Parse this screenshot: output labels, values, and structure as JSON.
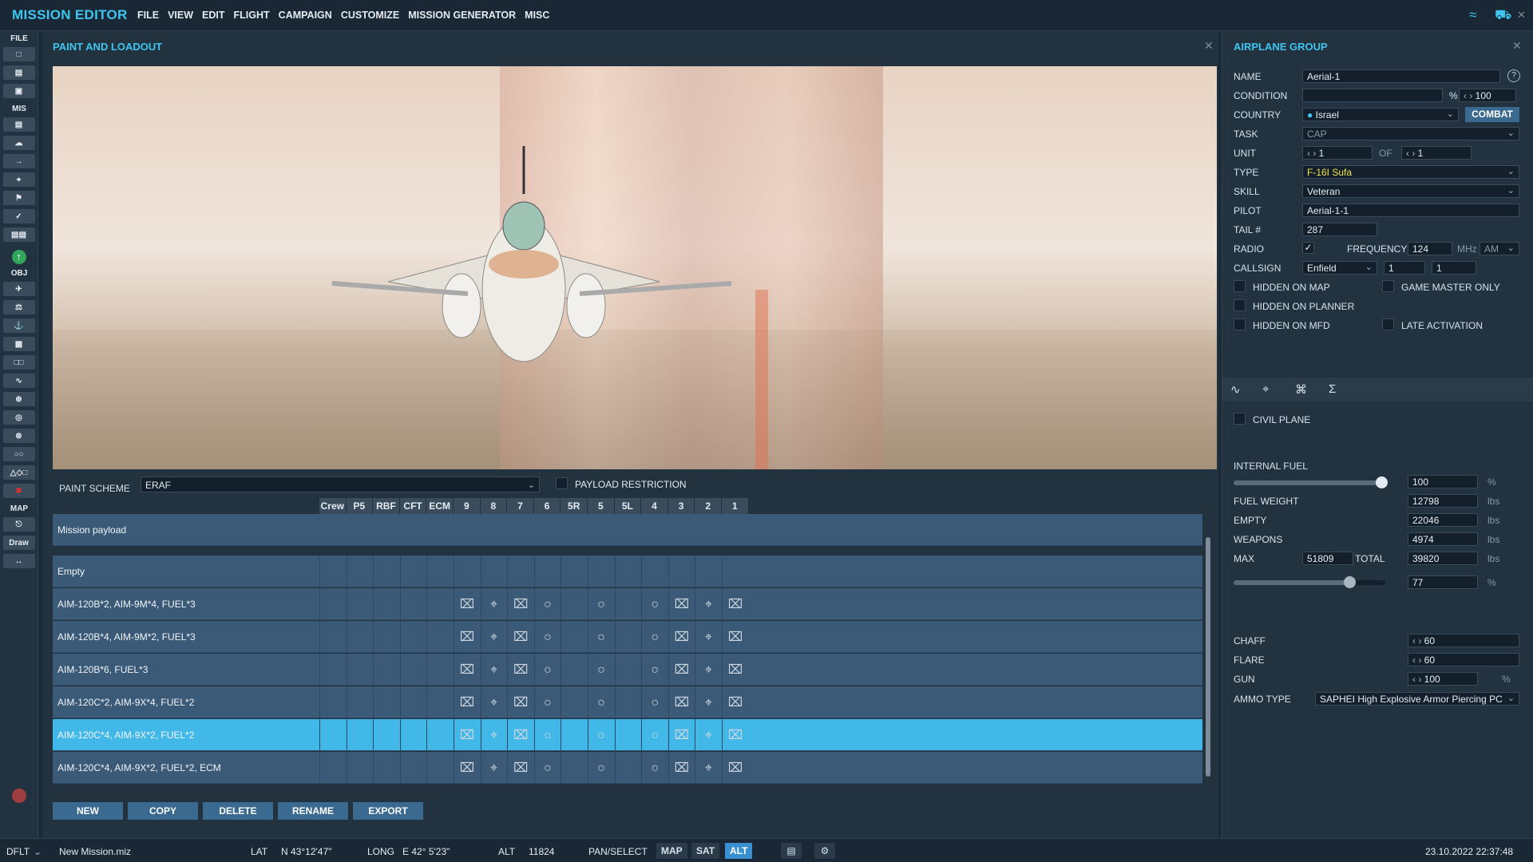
{
  "app": {
    "title": "MISSION EDITOR"
  },
  "menu": [
    "FILE",
    "VIEW",
    "EDIT",
    "FLIGHT",
    "CAMPAIGN",
    "CUSTOMIZE",
    "MISSION GENERATOR",
    "MISC"
  ],
  "toolbar": {
    "file": "FILE",
    "mis": "MIS",
    "obj": "OBJ",
    "map": "MAP",
    "draw": "Draw"
  },
  "paint_panel": {
    "title": "PAINT AND LOADOUT",
    "paint_scheme_label": "PAINT SCHEME",
    "paint_scheme_value": "ERAF",
    "payload_restriction_label": "PAYLOAD RESTRICTION",
    "columns": [
      "Crew",
      "P5",
      "RBF",
      "CFT",
      "ECM",
      "9",
      "8",
      "7",
      "6",
      "5R",
      "5",
      "5L",
      "4",
      "3",
      "2",
      "1"
    ],
    "mission_payload_label": "Mission payload",
    "loadouts": [
      "Empty",
      "AIM-120B*2, AIM-9M*4, FUEL*3",
      "AIM-120B*4, AIM-9M*2, FUEL*3",
      "AIM-120B*6, FUEL*3",
      "AIM-120C*2, AIM-9X*4, FUEL*2",
      "AIM-120C*4, AIM-9X*2, FUEL*2",
      "AIM-120C*4, AIM-9X*2, FUEL*2, ECM"
    ],
    "selected_index": 5,
    "buttons": {
      "new": "NEW",
      "copy": "COPY",
      "delete": "DELETE",
      "rename": "RENAME",
      "export": "EXPORT"
    }
  },
  "airplane_group": {
    "title": "AIRPLANE GROUP",
    "name_label": "NAME",
    "name_value": "Aerial-1",
    "condition_label": "CONDITION",
    "condition_pct": "%",
    "condition_value": "100",
    "country_label": "COUNTRY",
    "country_value": "Israel",
    "combat_button": "COMBAT",
    "task_label": "TASK",
    "task_value": "CAP",
    "unit_label": "UNIT",
    "unit_value": "1",
    "of_label": "OF",
    "of_value": "1",
    "type_label": "TYPE",
    "type_value": "F-16I Sufa",
    "skill_label": "SKILL",
    "skill_value": "Veteran",
    "pilot_label": "PILOT",
    "pilot_value": "Aerial-1-1",
    "tail_label": "TAIL #",
    "tail_value": "287",
    "radio_label": "RADIO",
    "frequency_label": "FREQUENCY",
    "frequency_value": "124",
    "mhz": "MHz",
    "modulation": "AM",
    "callsign_label": "CALLSIGN",
    "callsign_value": "Enfield",
    "callsign_n1": "1",
    "callsign_n2": "1",
    "hidden_on_map": "HIDDEN ON MAP",
    "game_master_only": "GAME MASTER ONLY",
    "hidden_on_planner": "HIDDEN ON PLANNER",
    "hidden_on_mfd": "HIDDEN ON MFD",
    "late_activation": "LATE ACTIVATION",
    "civil_plane": "CIVIL PLANE",
    "internal_fuel_label": "INTERNAL FUEL",
    "internal_fuel_value": "100",
    "pct": "%",
    "fuel_weight_label": "FUEL WEIGHT",
    "fuel_weight_value": "12798",
    "lbs": "lbs",
    "empty_label": "EMPTY",
    "empty_value": "22046",
    "weapons_label": "WEAPONS",
    "weapons_value": "4974",
    "max_label": "MAX",
    "max_value": "51809",
    "total_label": "TOTAL",
    "total_value": "39820",
    "load_pct_value": "77",
    "chaff_label": "CHAFF",
    "chaff_value": "60",
    "flare_label": "FLARE",
    "flare_value": "60",
    "gun_label": "GUN",
    "gun_value": "100",
    "ammo_type_label": "AMMO TYPE",
    "ammo_type_value": "SAPHEI High Explosive Armor Piercing PC"
  },
  "status": {
    "profile": "DFLT",
    "file": "New Mission.miz",
    "lat_label": "LAT",
    "lat_value": "N 43°12'47\"",
    "long_label": "LONG",
    "long_value": "E 42° 5'23\"",
    "alt_label": "ALT",
    "alt_value": "11824",
    "mode": "PAN/SELECT",
    "map": "MAP",
    "sat": "SAT",
    "alt_btn": "ALT",
    "datetime": "23.10.2022 22:37:48"
  },
  "colors": {
    "accent": "#3ec6f0",
    "selected_row": "#42b8e8",
    "combat": "#3a6a90",
    "type_text": "#f5e04a"
  }
}
